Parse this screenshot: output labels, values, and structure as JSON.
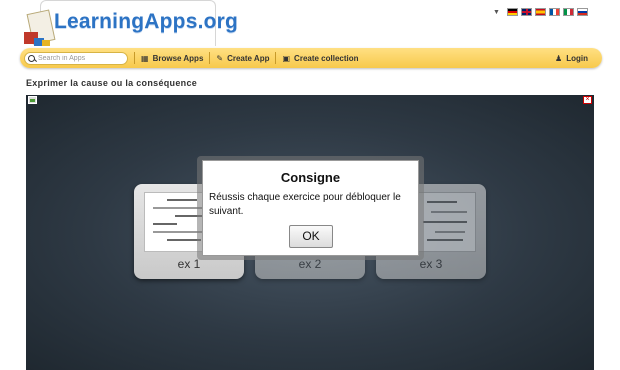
{
  "header": {
    "logo_text": "LearningApps.org",
    "languages": [
      {
        "icon": "flag-de"
      },
      {
        "icon": "flag-gb"
      },
      {
        "icon": "flag-es"
      },
      {
        "icon": "flag-fr"
      },
      {
        "icon": "flag-it"
      },
      {
        "icon": "flag-ru"
      }
    ]
  },
  "navbar": {
    "search_placeholder": "Search in Apps",
    "browse_label": "Browse Apps",
    "create_app_label": "Create App",
    "create_collection_label": "Create collection",
    "login_label": "Login",
    "bar_color": "#f7c94c"
  },
  "page": {
    "title": "Exprimer la cause ou la conséquence"
  },
  "app": {
    "exercises": [
      {
        "label": "ex 1"
      },
      {
        "label": "ex 2"
      },
      {
        "label": "ex 3"
      }
    ],
    "dialog": {
      "title": "Consigne",
      "text": "Réussis chaque exercice pour débloquer le suivant.",
      "ok_label": "OK"
    }
  }
}
